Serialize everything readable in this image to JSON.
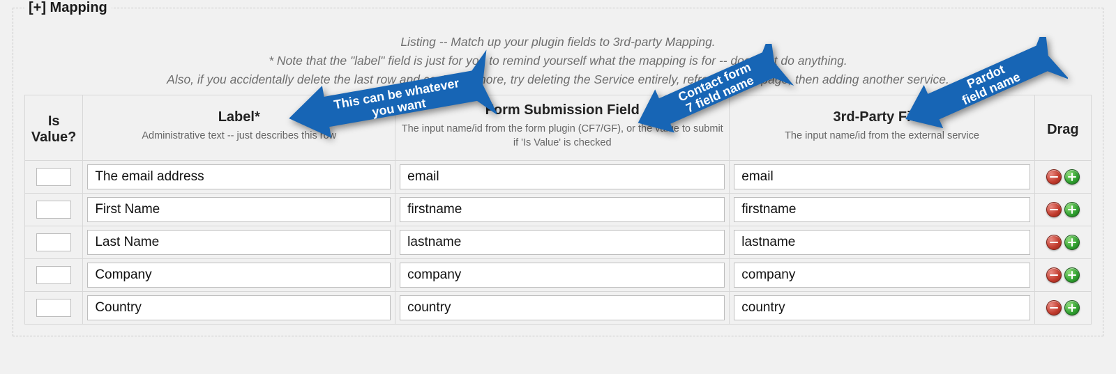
{
  "legend": "[+] Mapping",
  "intro": {
    "line1": "Listing -- Match up your plugin fields to 3rd-party Mapping.",
    "line2": "* Note that the \"label\" field is just for you to remind yourself what the mapping is for -- does not do anything.",
    "line3": "Also, if you accidentally delete the last row and can't add more, try deleting the Service entirely, refreshing the page, then adding another service."
  },
  "headers": {
    "isvalue": {
      "title": "Is Value?",
      "sub": ""
    },
    "label": {
      "title": "Label*",
      "sub": "Administrative text -- just describes this row"
    },
    "form": {
      "title": "Form Submission Field",
      "sub": "The input name/id from the form plugin (CF7/GF),\nor the value to submit if 'Is Value' is checked"
    },
    "third": {
      "title": "3rd-Party Field",
      "sub": "The input name/id from the external service"
    },
    "drag": {
      "title": "Drag",
      "sub": ""
    }
  },
  "rows": [
    {
      "label": "The email address",
      "form": "email",
      "third": "email"
    },
    {
      "label": "First Name",
      "form": "firstname",
      "third": "firstname"
    },
    {
      "label": "Last Name",
      "form": "lastname",
      "third": "lastname"
    },
    {
      "label": "Company",
      "form": "company",
      "third": "company"
    },
    {
      "label": "Country",
      "form": "country",
      "third": "country"
    }
  ],
  "callouts": {
    "label": {
      "line1": "This can be whatever",
      "line2": "you want"
    },
    "form": {
      "line1": "Contact form",
      "line2": "7 field name"
    },
    "third": {
      "line1": "Pardot",
      "line2": "field name"
    }
  }
}
